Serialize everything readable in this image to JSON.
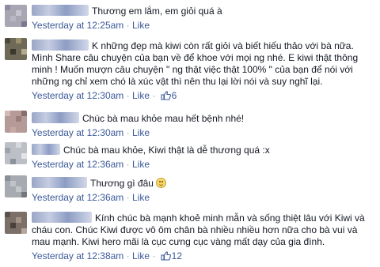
{
  "comments": [
    {
      "text": "Thương em lắm, em giỏi quá à",
      "timestamp": "Yesterday at 12:25am",
      "like_label": "Like",
      "like_count": ""
    },
    {
      "text": "K những đẹp mà kiwi còn rất giỏi và biết hiếu thảo với bà nữa. Mình Share câu chuyện của bạn về để khoe với mọi ng nhé. E kiwi thật thông minh ! Muốn mượn câu chuyện \" ng thật việc thật 100% \" của bạn để nói với những ng chỉ xem chó là xúc vật thì nên thu lại lời nói và suy nghĩ lại.",
      "timestamp": "Yesterday at 12:30am",
      "like_label": "Like",
      "like_count": "6"
    },
    {
      "text": "Chúc bà mau khỏe mau hết bệnh nhé!",
      "timestamp": "Yesterday at 12:30am",
      "like_label": "Like",
      "like_count": ""
    },
    {
      "text": "Chúc bà mau khỏe, Kiwi thật là dễ thương quá :x",
      "timestamp": "Yesterday at 12:36am",
      "like_label": "Like",
      "like_count": ""
    },
    {
      "text": "Thương gì đâu",
      "timestamp": "Yesterday at 12:36am",
      "like_label": "Like",
      "like_count": ""
    },
    {
      "text": "Kính chúc bà mạnh khoẻ minh mẫn và sống thiệt lâu với Kiwi và cháu con. Chúc Kiwi được vô ôm chân bà nhiều nhiều hơn nữa cho bà vui và mau mạnh. Kiwi hero mãi là cục cưng cục vàng mất dạy của gia đình.",
      "timestamp": "Yesterday at 12:38am",
      "like_label": "Like",
      "like_count": "12"
    }
  ],
  "colors": {
    "link": "#3b5998",
    "meta": "#90949c",
    "text": "#141823"
  },
  "icons": [
    "thumbs-up-icon",
    "smiley-emoji-icon"
  ]
}
